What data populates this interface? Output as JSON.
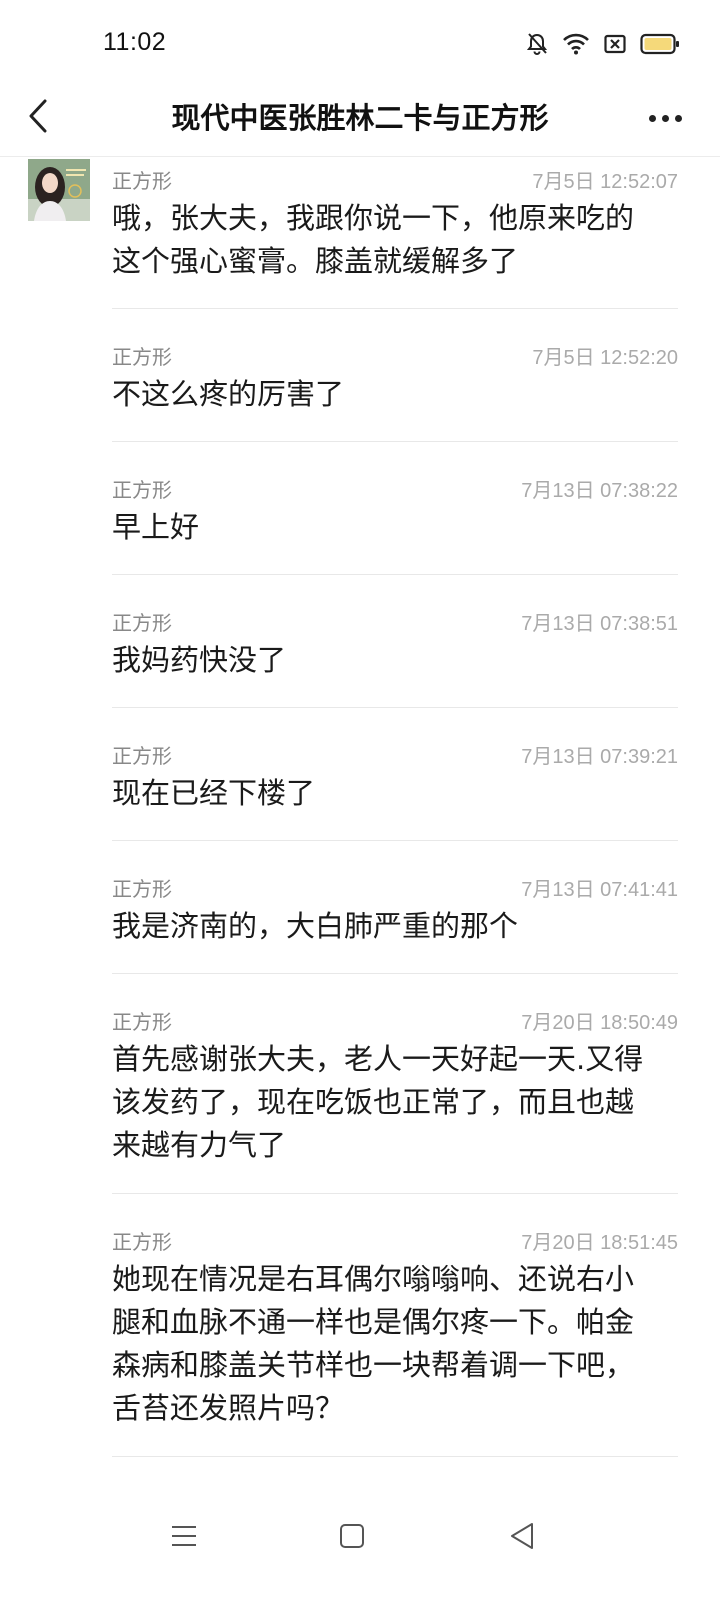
{
  "status_bar": {
    "time": "11:02",
    "icons": [
      "mute-bell-icon",
      "wifi-icon",
      "sim-x-icon",
      "battery-icon"
    ],
    "battery_color": "#f5d97a"
  },
  "header": {
    "title": "现代中医张胜林二卡与正方形",
    "back_icon": "chevron-left-icon",
    "more_icon": "more-dots-icon"
  },
  "messages": [
    {
      "sender": "正方形",
      "time": "7月5日 12:52:07",
      "lines": [
        "哦，张大夫，我跟你说一下，他原来吃的",
        "这个强心蜜膏。膝盖就缓解多了"
      ]
    },
    {
      "sender": "正方形",
      "time": "7月5日 12:52:20",
      "lines": [
        "不这么疼的厉害了"
      ]
    },
    {
      "sender": "正方形",
      "time": "7月13日 07:38:22",
      "lines": [
        "早上好"
      ]
    },
    {
      "sender": "正方形",
      "time": "7月13日 07:38:51",
      "lines": [
        "我妈药快没了"
      ]
    },
    {
      "sender": "正方形",
      "time": "7月13日 07:39:21",
      "lines": [
        "现在已经下楼了"
      ]
    },
    {
      "sender": "正方形",
      "time": "7月13日 07:41:41",
      "lines": [
        "我是济南的，大白肺严重的那个"
      ]
    },
    {
      "sender": "正方形",
      "time": "7月20日 18:50:49",
      "lines": [
        "首先感谢张大夫，老人一天好起一天.又得",
        "该发药了，现在吃饭也正常了，而且也越",
        "来越有力气了"
      ]
    },
    {
      "sender": "正方形",
      "time": "7月20日 18:51:45",
      "lines": [
        "她现在情况是右耳偶尔嗡嗡响、还说右小",
        "腿和血脉不通一样也是偶尔疼一下。帕金",
        "森病和膝盖关节样也一块帮着调一下吧，",
        "舌苔还发照片吗？"
      ]
    }
  ],
  "nav_bar": {
    "buttons": [
      "menu-icon",
      "home-icon",
      "back-triangle-icon"
    ]
  }
}
